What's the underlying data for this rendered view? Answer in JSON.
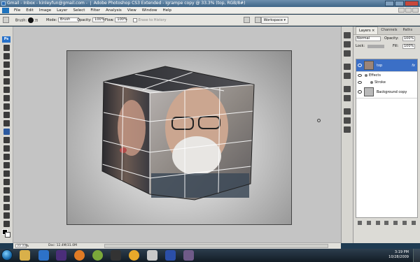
{
  "window": {
    "title": "Gmail - Inbox - kinleyfun@gmail.com - Adobe Photoshop CS3 Extended - Igrampe copy @ 33.3% (top, RGB/8#) - Mozilla Firefox",
    "title_display": "Gmail - Inbox - kinleyfun@gmail.com - ❘ Adobe Photoshop CS3 Extended - Igrampe copy @ 33.3% (top, RGB/8#)"
  },
  "menu": [
    "File",
    "Edit",
    "Image",
    "Layer",
    "Select",
    "Filter",
    "Analysis",
    "View",
    "Window",
    "Help"
  ],
  "options": {
    "brush_label": "Brush:",
    "brush_size": "35",
    "mode_label": "Mode:",
    "mode_value": "Brush",
    "opacity_label": "Opacity:",
    "opacity_value": "100%",
    "flow_label": "Flow:",
    "flow_value": "100%",
    "erase_label": "Erase to History",
    "workspace_label": "Workspace ▾"
  },
  "tools": {
    "ps_label": "Ps"
  },
  "status": {
    "zoom": "33.33%",
    "doc": "Doc: 12.4M/31.0M"
  },
  "layers_panel": {
    "tabs": [
      "Layers ×",
      "Channels",
      "Paths"
    ],
    "blend_mode": "Normal",
    "opacity_label": "Opacity:",
    "opacity_value": "100%",
    "lock_label": "Lock:",
    "fill_label": "Fill:",
    "fill_value": "100%",
    "layers": [
      {
        "name": "top",
        "fx": "fx"
      },
      {
        "name": "Background copy"
      }
    ],
    "effects_label": "Effects",
    "stroke_label": "Stroke"
  },
  "taskbar": {
    "time": "3:19 PM",
    "date": "10/28/2009"
  },
  "colors": {
    "title_bar": "#3e6587",
    "selected_layer": "#3b6fc6",
    "taskbar": "#121c25"
  }
}
